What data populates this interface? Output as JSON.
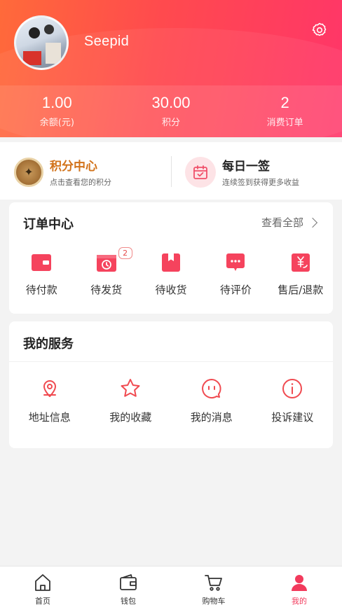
{
  "profile": {
    "username": "Seepid",
    "stats": [
      {
        "value": "1.00",
        "label": "余额(元)"
      },
      {
        "value": "30.00",
        "label": "积分"
      },
      {
        "value": "2",
        "label": "消费订单"
      }
    ]
  },
  "quick_links": {
    "points": {
      "title": "积分中心",
      "subtitle": "点击查看您的积分"
    },
    "signin": {
      "title": "每日一签",
      "subtitle": "连续签到获得更多收益"
    }
  },
  "orders": {
    "title": "订单中心",
    "view_all": "查看全部",
    "items": [
      {
        "label": "待付款",
        "icon": "wallet-icon"
      },
      {
        "label": "待发货",
        "icon": "clock-box-icon",
        "badge": "2"
      },
      {
        "label": "待收货",
        "icon": "package-icon"
      },
      {
        "label": "待评价",
        "icon": "comment-icon"
      },
      {
        "label": "售后/退款",
        "icon": "refund-icon"
      }
    ]
  },
  "services": {
    "title": "我的服务",
    "items": [
      {
        "label": "地址信息",
        "icon": "location-icon"
      },
      {
        "label": "我的收藏",
        "icon": "star-icon"
      },
      {
        "label": "我的消息",
        "icon": "message-icon"
      },
      {
        "label": "投诉建议",
        "icon": "info-icon"
      }
    ]
  },
  "bottom_nav": {
    "items": [
      {
        "label": "首页",
        "icon": "home-icon"
      },
      {
        "label": "钱包",
        "icon": "wallet-icon"
      },
      {
        "label": "购物车",
        "icon": "cart-icon"
      },
      {
        "label": "我的",
        "icon": "user-icon",
        "active": true
      }
    ]
  },
  "colors": {
    "accent": "#f23a5c",
    "header_start": "#ff6a3a",
    "header_end": "#ff3569",
    "points_title": "#d2731b"
  }
}
